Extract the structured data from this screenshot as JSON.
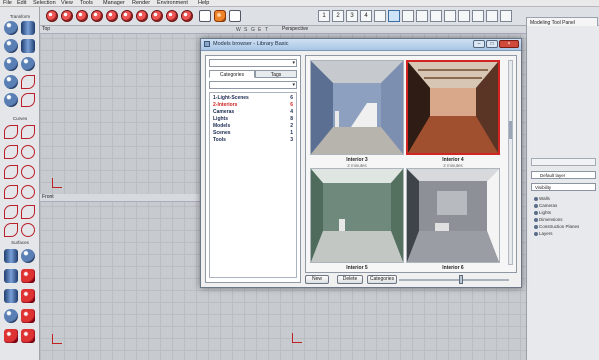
{
  "menu": [
    "File",
    "Edit",
    "Selection",
    "View",
    "Tools",
    "Manager",
    "Render",
    "Environment",
    "Help"
  ],
  "toolbar": {
    "view_buttons": [
      "1",
      "2",
      "3",
      "4"
    ],
    "tool_panel_label": "Modeling Tool Panel"
  },
  "left_tools": {
    "group1_title": "Transform",
    "group2_title": "Curves",
    "group3_title": "Surfaces"
  },
  "viewports": {
    "top": {
      "title": "Top",
      "labels": [
        "W",
        "S",
        "G",
        "E",
        "T"
      ]
    },
    "front": {
      "title": "Front",
      "labels": [
        "W",
        "S",
        "G",
        "E",
        "T"
      ]
    },
    "perspective": {
      "title": "Perspective",
      "labels": [
        "W",
        "S",
        "G",
        "E",
        "T"
      ]
    }
  },
  "right_panel": {
    "layer_dropdown": "Default layer",
    "visibility_dropdown": "Visibility",
    "items": [
      "Walls",
      "Cameras",
      "Lights",
      "Dimensions",
      "Construction Planes",
      "Layers"
    ]
  },
  "dialog": {
    "title": "Models browser - Library Basic",
    "tabs": [
      "Categories",
      "Tags"
    ],
    "categories": [
      {
        "name": "1-Light-Scenes",
        "count": "6"
      },
      {
        "name": "2-Interiors",
        "count": "6"
      },
      {
        "name": "Cameras",
        "count": "4"
      },
      {
        "name": "Lights",
        "count": "8"
      },
      {
        "name": "Models",
        "count": "2"
      },
      {
        "name": "Scenes",
        "count": "1"
      },
      {
        "name": "Tools",
        "count": "3"
      }
    ],
    "thumbnails": [
      {
        "name": "Interior 3",
        "sub": "2 minutes"
      },
      {
        "name": "Interior 4",
        "sub": "2 minutes"
      },
      {
        "name": "Interior 5",
        "sub": ""
      },
      {
        "name": "Interior 6",
        "sub": ""
      }
    ],
    "buttons": {
      "new": "New",
      "delete": "Delete",
      "categories": "Categories"
    }
  }
}
